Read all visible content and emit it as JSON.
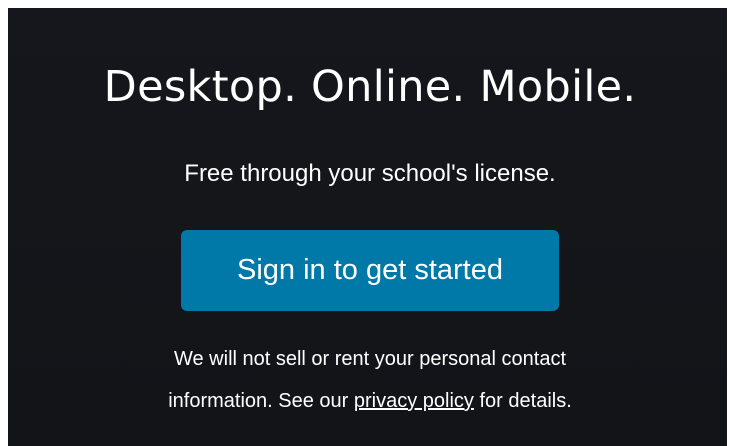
{
  "promo": {
    "headline": "Desktop. Online. Mobile.",
    "subhead": "Free through your school's license.",
    "signin_label": "Sign in to get started",
    "notice": {
      "line1": "We will not sell or rent your personal contact",
      "line2_prefix": "information. See our ",
      "privacy_link": "privacy policy",
      "line2_suffix": " for details."
    }
  },
  "colors": {
    "panel_background": "#13151a",
    "button_background": "#0078a8",
    "text": "#ffffff"
  }
}
